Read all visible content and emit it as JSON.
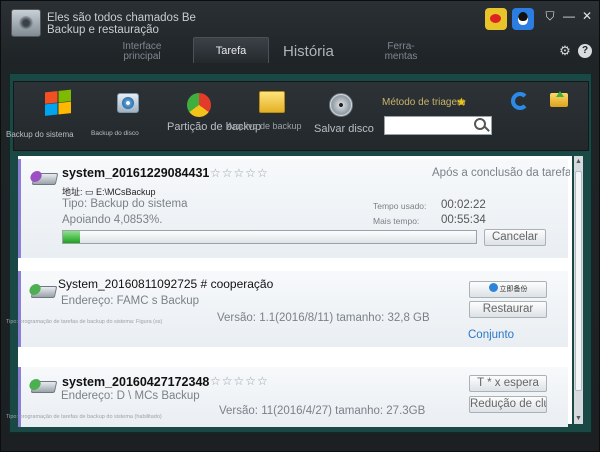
{
  "app": {
    "title_line1": "Eles são todos chamados Be",
    "title_line2": "Backup e restauração"
  },
  "titlebar": {
    "skin": "⛉",
    "minimize": "—",
    "close": "✕"
  },
  "tabs": {
    "interface_l1": "Interface",
    "interface_l2": "principal",
    "task": "Tarefa",
    "history": "História",
    "tools_l1": "Ferra-",
    "tools_l2": "mentas"
  },
  "toolbar": {
    "system_backup": "Backup do sistema",
    "disk_backup": "Backup do disco",
    "partition_backup": "Partição de backup",
    "file_backup": "Arquivo de backup",
    "save_disk": "Salvar disco",
    "sort_method": "Método de triagem",
    "sort_star": "★",
    "search_value": ""
  },
  "tasks": [
    {
      "name": "system_20161229084431",
      "stars": "☆☆☆☆☆",
      "after_completion": "Após a conclusão da tarefa, o com",
      "address": "地址:  ▭ E:\\MCsBackup",
      "type": "Tipo: Backup do sistema",
      "status": "Apoiando 4,0853%.",
      "time_used_label": "Tempo usado:",
      "time_used": "00:02:22",
      "time_left_label": "Mais tempo:",
      "time_left": "00:55:34",
      "progress": 0.04,
      "cancel": "Cancelar"
    },
    {
      "name": "System_20160811092725 # cooperação",
      "address": "Endereço: FAMC s Backup",
      "schedule": "Tipo: programação de tarefas de backup do sistema: Figura (ss)",
      "version": "Versão: 1.1(2016/8/11) tamanho: 32,8 GB",
      "backup_now": "立即备份",
      "restore": "Restaurar",
      "set": "Conjunto"
    },
    {
      "name": "system_20160427172348",
      "stars": "☆☆☆☆☆",
      "address": "Endereço: D \\ MCs Backup",
      "schedule": "Tipo: programação de tarefas de backup do sistema (habilitado)",
      "version": "Versão: 11(2016/4/27) tamanho: 27.3GB",
      "wait": "T * x espera",
      "reduce": "Redução de cluster"
    }
  ],
  "colors": {
    "accent": "#1a4945",
    "progress": "#1fa21f",
    "card_border": "#8b7fd6"
  }
}
